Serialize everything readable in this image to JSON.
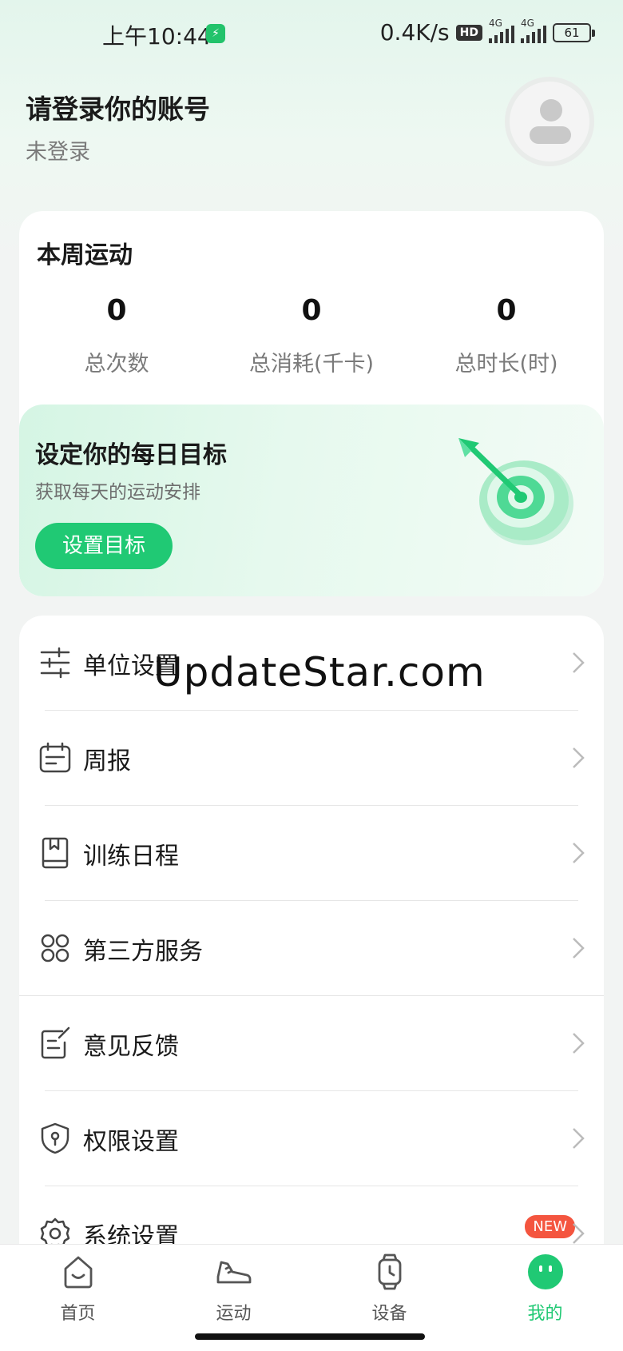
{
  "status_bar": {
    "time": "上午10:44",
    "network_speed": "0.4K/s",
    "hd_label": "HD",
    "sim1_label": "4G",
    "sim2_label": "4G",
    "battery": "61"
  },
  "header": {
    "title": "请登录你的账号",
    "subtitle": "未登录",
    "avatar_icon": "user-avatar-icon"
  },
  "weekly": {
    "title": "本周运动",
    "stats": [
      {
        "value": "0",
        "label": "总次数"
      },
      {
        "value": "0",
        "label": "总消耗(千卡)"
      },
      {
        "value": "0",
        "label": "总时长(时)"
      }
    ]
  },
  "goal": {
    "title": "设定你的每日目标",
    "subtitle": "获取每天的运动安排",
    "button_label": "设置目标",
    "icon": "target-dart-icon"
  },
  "menu": {
    "items": [
      {
        "label": "单位设置",
        "icon": "sliders-icon"
      },
      {
        "label": "周报",
        "icon": "calendar-icon"
      },
      {
        "label": "训练日程",
        "icon": "book-icon"
      },
      {
        "label": "第三方服务",
        "icon": "grid-apps-icon"
      },
      {
        "label": "意见反馈",
        "icon": "edit-note-icon"
      },
      {
        "label": "权限设置",
        "icon": "shield-lock-icon"
      },
      {
        "label": "系统设置",
        "icon": "gear-icon",
        "badge": "NEW"
      }
    ]
  },
  "watermark": "UpdateStar.com",
  "tabbar": {
    "tabs": [
      {
        "label": "首页",
        "icon": "home-icon",
        "active": false
      },
      {
        "label": "运动",
        "icon": "sneaker-icon",
        "active": false
      },
      {
        "label": "设备",
        "icon": "watch-icon",
        "active": false
      },
      {
        "label": "我的",
        "icon": "profile-face-icon",
        "active": true
      }
    ]
  },
  "colors": {
    "accent": "#20c974",
    "badge": "#f4553f",
    "text_primary": "#1a1a1a",
    "text_secondary": "#7a7a7a"
  }
}
